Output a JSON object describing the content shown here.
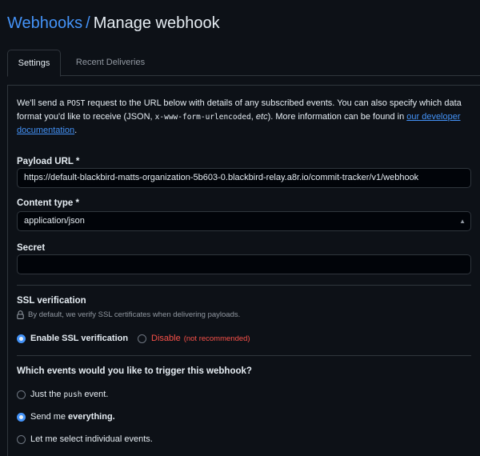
{
  "breadcrumb": {
    "parent": "Webhooks",
    "separator": "/",
    "current": "Manage webhook"
  },
  "tabs": [
    {
      "label": "Settings",
      "active": true
    },
    {
      "label": "Recent Deliveries",
      "active": false
    }
  ],
  "intro": {
    "part1": "We'll send a ",
    "method": "POST",
    "part2": " request to the URL below with details of any subscribed events. You can also specify which data format you'd like to receive (JSON, ",
    "encoding": "x-www-form-urlencoded",
    "part3": ", ",
    "etc": "etc",
    "part4": "). More information can be found in ",
    "link_text": "our developer documentation",
    "part5": "."
  },
  "payload_url": {
    "label": "Payload URL *",
    "value": "https://default-blackbird-matts-organization-5b603-0.blackbird-relay.a8r.io/commit-tracker/v1/webhook"
  },
  "content_type": {
    "label": "Content type *",
    "value": "application/json"
  },
  "secret": {
    "label": "Secret",
    "value": ""
  },
  "ssl": {
    "heading": "SSL verification",
    "hint": "By default, we verify SSL certificates when delivering payloads.",
    "enable_label": "Enable SSL verification",
    "disable_label": "Disable",
    "disable_note": "(not recommended)",
    "selected": "enable"
  },
  "events": {
    "heading": "Which events would you like to trigger this webhook?",
    "option_push_prefix": "Just the",
    "option_push_code": "push",
    "option_push_suffix": "event.",
    "option_all_prefix": "Send me",
    "option_all_bold": "everything.",
    "option_select": "Let me select individual events.",
    "selected": "everything"
  },
  "colors": {
    "background": "#0d1117",
    "accent": "#4493f8",
    "danger": "#f85149",
    "border": "#30363d"
  }
}
